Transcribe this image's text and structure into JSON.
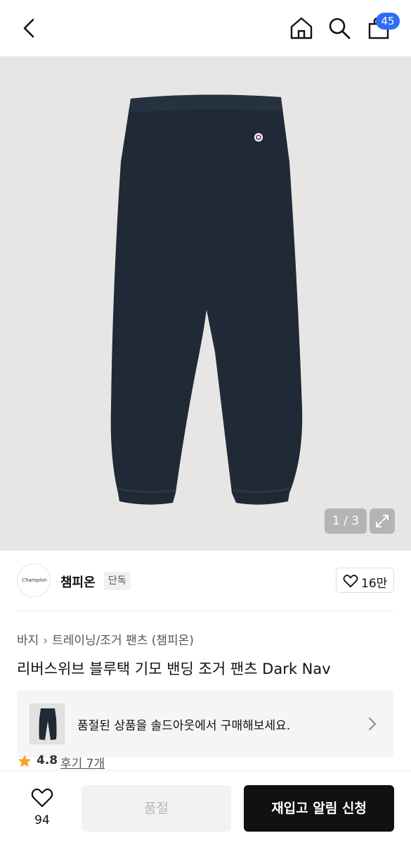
{
  "header": {
    "cart_badge": "45",
    "icons": [
      "back-arrow-icon",
      "home-icon",
      "search-icon",
      "shopping-bag-icon"
    ]
  },
  "gallery": {
    "pager": "1 / 3",
    "image_description": "dark navy jogger pants"
  },
  "brand": {
    "logo_text": "Champion",
    "name": "챔피온",
    "tag": "단독",
    "likes": "16만"
  },
  "breadcrumb": {
    "level1": "바지",
    "level2": "트레이닝/조거 팬츠 (챔피온)"
  },
  "product": {
    "title": "리버스위브 블루택 기모 밴딩 조거 팬츠 Dark Nav"
  },
  "soldout_banner": {
    "text": "품절된 상품을 솔드아웃에서 구매해보세요."
  },
  "rating": {
    "score": "4.8",
    "reviews": "후기 7개"
  },
  "bottom_bar": {
    "wish_count": "94",
    "soldout_label": "품절",
    "restock_label": "재입고 알림 신청"
  },
  "colors": {
    "badge": "#2f6df6",
    "primary_button": "#111111",
    "disabled_button": "#f2f2f2",
    "hero_background": "#e7e6e4",
    "pants": "#1f2a36"
  }
}
